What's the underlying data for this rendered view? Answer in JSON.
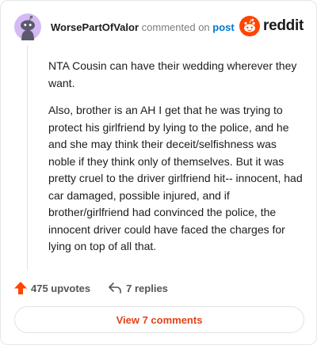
{
  "comment": {
    "author": "WorsePartOfValor",
    "action_text": "commented on",
    "target_text": "post",
    "paragraphs": [
      "NTA Cousin can have their wedding wherever they want.",
      "Also, brother is an AH I get that he was trying to protect his girlfriend by lying to the police, and he and she may think their deceit/selfishness was noble if they think only of themselves. But it was pretty cruel to the driver girlfriend hit-- innocent, had car damaged, possible injured, and if brother/girlfriend had convinced the police, the innocent driver could have faced the charges for lying on top of all that."
    ]
  },
  "brand": {
    "name": "reddit",
    "color": "#ff4500"
  },
  "actions": {
    "upvotes": "475 upvotes",
    "replies": "7 replies",
    "upvote_color": "#ff4500"
  },
  "footer": {
    "view_comments": "View 7 comments"
  },
  "icons": {
    "avatar": "snoo-avatar-icon",
    "logo": "reddit-logo-icon",
    "upvote": "upvote-arrow-icon",
    "reply": "reply-arrow-icon"
  }
}
